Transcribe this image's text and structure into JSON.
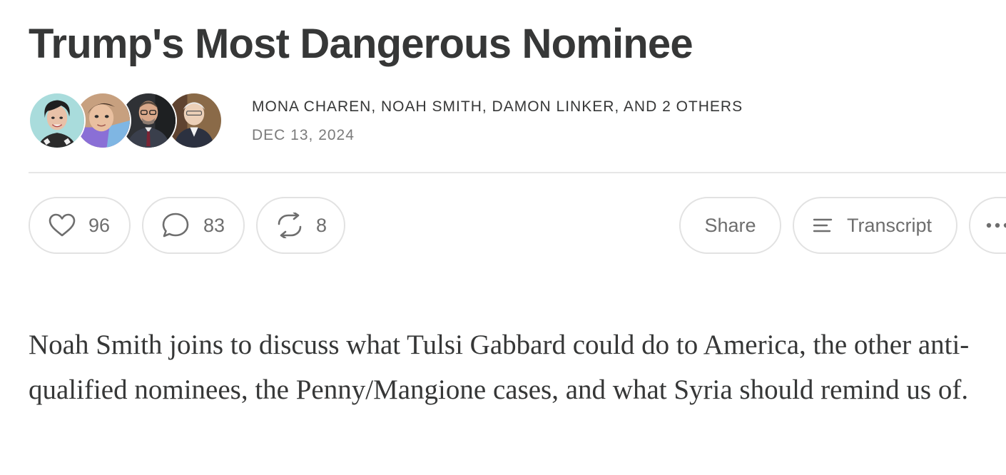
{
  "post": {
    "title": "Trump's Most Dangerous Nominee",
    "byline": "MONA CHAREN, NOAH SMITH, DAMON LINKER, AND 2 OTHERS",
    "date": "DEC 13, 2024",
    "description": "Noah Smith joins to discuss what Tulsi Gabbard could do to America, the other anti-qualified nominees, the Penny/Mangione cases, and what Syria should remind us of."
  },
  "author_avatars": [
    {
      "icon": "author-avatar-1",
      "bg": "#a9dcdc"
    },
    {
      "icon": "author-avatar-2",
      "bg": "#c7a07f"
    },
    {
      "icon": "author-avatar-3",
      "bg": "#2f3135"
    },
    {
      "icon": "author-avatar-4",
      "bg": "#8a6a48"
    }
  ],
  "actions": {
    "like": {
      "icon": "heart-icon",
      "count": "96"
    },
    "comment": {
      "icon": "comment-bubble-icon",
      "count": "83"
    },
    "restack": {
      "icon": "restack-arrows-icon",
      "count": "8"
    },
    "share": {
      "label": "Share"
    },
    "transcript": {
      "icon": "lines-icon",
      "label": "Transcript"
    },
    "more": {
      "icon": "ellipsis-icon"
    }
  },
  "colors": {
    "text": "#363737",
    "muted": "#7b7b7b",
    "border": "#e2e2e2",
    "icon": "#6e6e6e"
  }
}
